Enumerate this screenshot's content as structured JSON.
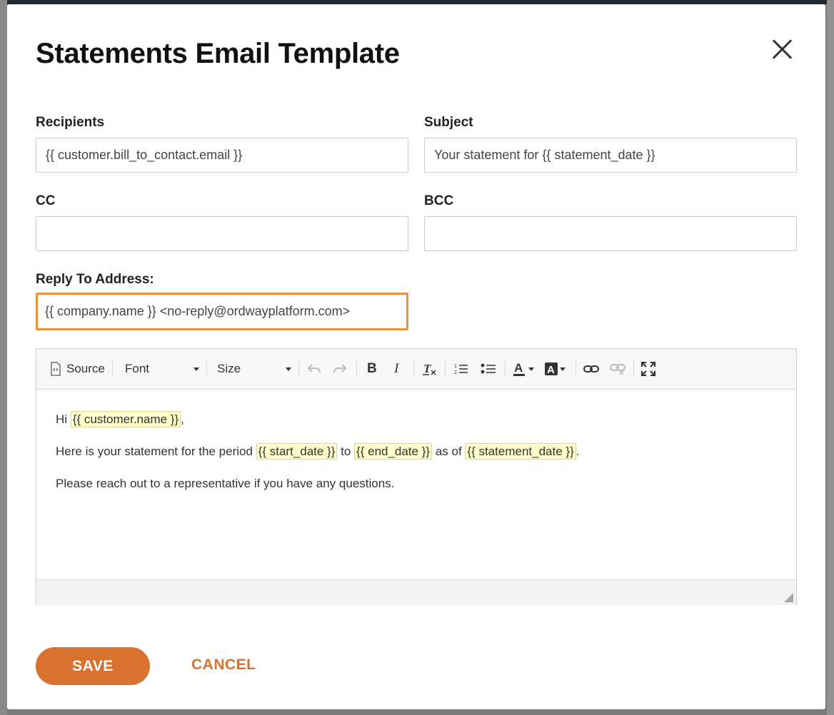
{
  "modal": {
    "title": "Statements Email Template",
    "close_label": "×"
  },
  "form": {
    "recipients": {
      "label": "Recipients",
      "value": "{{ customer.bill_to_contact.email }}"
    },
    "subject": {
      "label": "Subject",
      "value": "Your statement for {{ statement_date }}"
    },
    "cc": {
      "label": "CC",
      "value": ""
    },
    "bcc": {
      "label": "BCC",
      "value": ""
    },
    "reply_to": {
      "label": "Reply To Address:",
      "value": "{{ company.name }} <no-reply@ordwayplatform.com>"
    }
  },
  "editor": {
    "toolbar": {
      "source_label": "Source",
      "font_label": "Font",
      "size_label": "Size"
    },
    "body": {
      "line1_pre": "Hi ",
      "line1_ph": "{{ customer.name }}",
      "line1_post": ",",
      "line2_pre": "Here is your statement for the period ",
      "line2_ph1": "{{ start_date }}",
      "line2_mid1": " to ",
      "line2_ph2": "{{ end_date }}",
      "line2_mid2": " as of ",
      "line2_ph3": "{{ statement_date }}",
      "line2_post": ".",
      "line3": "Please reach out to a representative if you have any questions."
    }
  },
  "actions": {
    "save_label": "SAVE",
    "cancel_label": "CANCEL"
  },
  "colors": {
    "accent": "#d9722f",
    "focus_border": "#e8943a",
    "placeholder_bg": "#ffffcc"
  }
}
